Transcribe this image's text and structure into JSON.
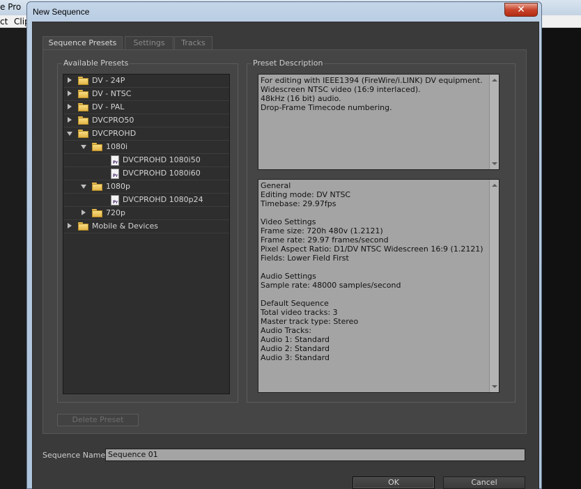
{
  "background_app": {
    "title_fragment": "e Pro",
    "menu_left": "ct",
    "menu_clip": "Clip"
  },
  "dialog": {
    "title": "New Sequence",
    "close_glyph": "✕"
  },
  "tabs": [
    {
      "label": "Sequence Presets",
      "active": true
    },
    {
      "label": "Settings",
      "active": false
    },
    {
      "label": "Tracks",
      "active": false
    }
  ],
  "presets": {
    "group_label": "Available Presets",
    "tree": [
      {
        "label": "DV - 24P",
        "type": "folder",
        "level": 0,
        "expanded": false
      },
      {
        "label": "DV - NTSC",
        "type": "folder",
        "level": 0,
        "expanded": false
      },
      {
        "label": "DV - PAL",
        "type": "folder",
        "level": 0,
        "expanded": false
      },
      {
        "label": "DVCPRO50",
        "type": "folder",
        "level": 0,
        "expanded": false
      },
      {
        "label": "DVCPROHD",
        "type": "folder",
        "level": 0,
        "expanded": true
      },
      {
        "label": "1080i",
        "type": "folder",
        "level": 1,
        "expanded": true
      },
      {
        "label": "DVCPROHD 1080i50",
        "type": "preset",
        "level": 2
      },
      {
        "label": "DVCPROHD 1080i60",
        "type": "preset",
        "level": 2
      },
      {
        "label": "1080p",
        "type": "folder",
        "level": 1,
        "expanded": true
      },
      {
        "label": "DVCPROHD 1080p24",
        "type": "preset",
        "level": 2
      },
      {
        "label": "720p",
        "type": "folder",
        "level": 1,
        "expanded": false
      },
      {
        "label": "Mobile & Devices",
        "type": "folder",
        "level": 0,
        "expanded": false
      }
    ],
    "delete_button": "Delete Preset"
  },
  "description": {
    "group_label": "Preset Description",
    "summary_lines": [
      "For editing with IEEE1394 (FireWire/i.LINK) DV equipment.",
      "Widescreen NTSC video (16:9 interlaced).",
      "48kHz (16 bit) audio.",
      "Drop-Frame Timecode numbering."
    ],
    "detail_lines": [
      "General",
      " Editing mode: DV NTSC",
      " Timebase: 29.97fps",
      "",
      "Video Settings",
      " Frame size: 720h 480v (1.2121)",
      " Frame rate: 29.97 frames/second",
      " Pixel Aspect Ratio: D1/DV NTSC Widescreen 16:9 (1.2121)",
      " Fields: Lower Field First",
      "",
      "Audio Settings",
      " Sample rate: 48000 samples/second",
      "",
      "Default Sequence",
      " Total video tracks: 3",
      " Master track type: Stereo",
      " Audio Tracks:",
      " Audio 1: Standard",
      " Audio 2: Standard",
      " Audio 3: Standard"
    ]
  },
  "sequence_name": {
    "label": "Sequence Name:",
    "value": "Sequence 01"
  },
  "footer": {
    "ok": "OK",
    "cancel": "Cancel"
  }
}
